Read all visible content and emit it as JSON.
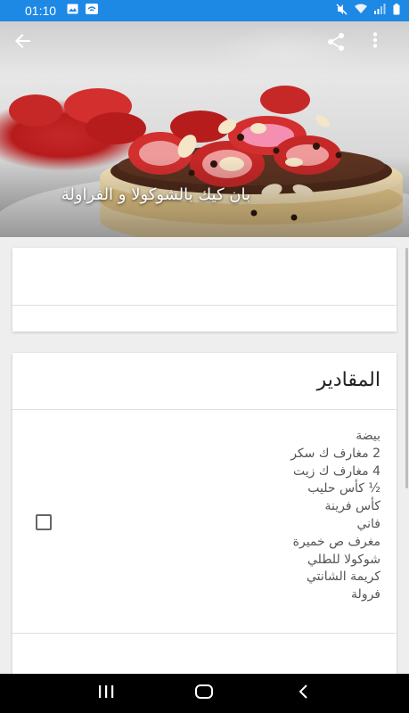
{
  "status_bar": {
    "time": "01:10",
    "icons": [
      "image-icon",
      "wifi-hotspot-icon",
      "mute-icon",
      "wifi-icon",
      "signal-icon",
      "battery-icon"
    ],
    "color": "#1e88e5"
  },
  "header": {
    "title": "بان كيك بالشوكولا و الفراولة",
    "back_icon": "arrow-back-icon",
    "share_icon": "share-icon",
    "menu_icon": "more-vert-icon"
  },
  "ingredients_card": {
    "title": "المقادير",
    "items": [
      "بيضة",
      "2 مغارف ك سكر",
      "4 مغارف ك زيت",
      "½ كأس حليب",
      "كأس فرينة",
      "فاني",
      "مغرف ص خميرة",
      "شوكولا للطلي",
      "كريمة الشانتي",
      "فرولة"
    ],
    "checkbox_checked": false
  },
  "nav_bar": {
    "icons": [
      "recent-apps-icon",
      "home-icon",
      "back-nav-icon"
    ]
  }
}
